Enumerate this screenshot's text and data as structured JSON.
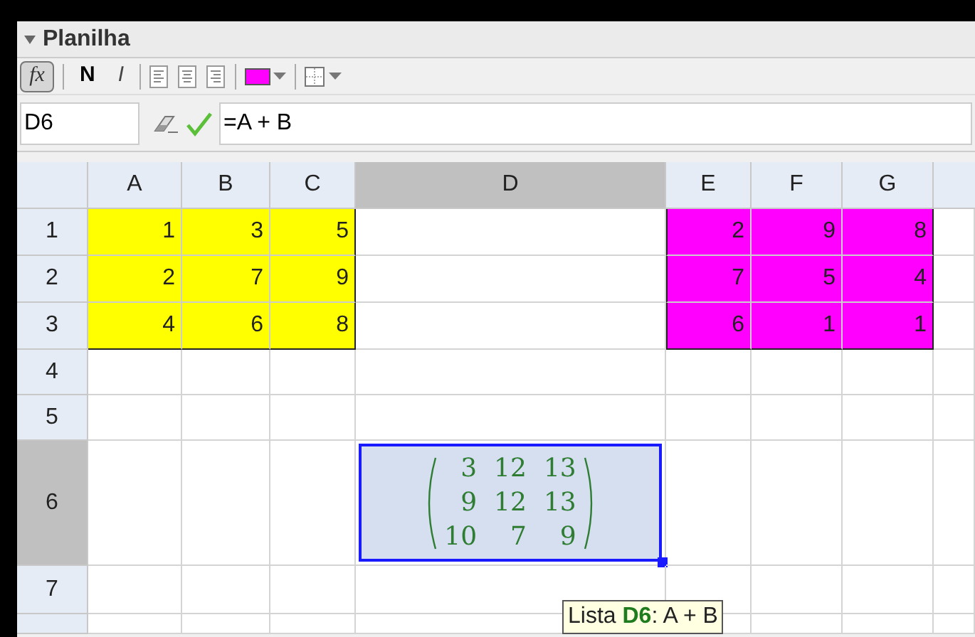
{
  "panel": {
    "title": "Planilha",
    "expanded": true
  },
  "toolbar": {
    "formula_button": {
      "label": "fx",
      "selected": true
    },
    "bold": {
      "label": "N",
      "selected": false
    },
    "italic": {
      "label": "I",
      "selected": false
    },
    "color_button": {
      "color": "#ff00ff"
    }
  },
  "formula_bar": {
    "cell_name": "D6",
    "formula": "=A + B"
  },
  "columns": [
    {
      "label": "A",
      "selected": false
    },
    {
      "label": "B",
      "selected": false
    },
    {
      "label": "C",
      "selected": false
    },
    {
      "label": "D",
      "selected": true
    },
    {
      "label": "E",
      "selected": false
    },
    {
      "label": "F",
      "selected": false
    },
    {
      "label": "G",
      "selected": false
    }
  ],
  "rows": [
    {
      "label": "1",
      "selected": false,
      "cells": [
        {
          "value": "1",
          "color": "#ffff00"
        },
        {
          "value": "3",
          "color": "#ffff00"
        },
        {
          "value": "5",
          "color": "#ffff00"
        },
        {},
        {
          "value": "2",
          "color": "#ff00ff"
        },
        {
          "value": "9",
          "color": "#ff00ff"
        },
        {
          "value": "8",
          "color": "#ff00ff"
        }
      ]
    },
    {
      "label": "2",
      "selected": false,
      "cells": [
        {
          "value": "2",
          "color": "#ffff00"
        },
        {
          "value": "7",
          "color": "#ffff00"
        },
        {
          "value": "9",
          "color": "#ffff00"
        },
        {},
        {
          "value": "7",
          "color": "#ff00ff"
        },
        {
          "value": "5",
          "color": "#ff00ff"
        },
        {
          "value": "4",
          "color": "#ff00ff"
        }
      ]
    },
    {
      "label": "3",
      "selected": false,
      "cells": [
        {
          "value": "4",
          "color": "#ffff00"
        },
        {
          "value": "6",
          "color": "#ffff00"
        },
        {
          "value": "8",
          "color": "#ffff00"
        },
        {},
        {
          "value": "6",
          "color": "#ff00ff"
        },
        {
          "value": "1",
          "color": "#ff00ff"
        },
        {
          "value": "1",
          "color": "#ff00ff"
        }
      ]
    },
    {
      "label": "4",
      "selected": false,
      "cells": []
    },
    {
      "label": "5",
      "selected": false,
      "cells": []
    },
    {
      "label": "6",
      "selected": true,
      "cells": [
        {},
        {},
        {},
        {
          "kind": "matrix",
          "selected": true,
          "matrix": [
            [
              "3",
              "12",
              "13"
            ],
            [
              "9",
              "12",
              "13"
            ],
            [
              "10",
              "7",
              "9"
            ]
          ]
        }
      ]
    },
    {
      "label": "7",
      "selected": false,
      "cells": []
    },
    {
      "selected": false,
      "cells": []
    }
  ],
  "tooltip": "Lista **D6**: A + B"
}
